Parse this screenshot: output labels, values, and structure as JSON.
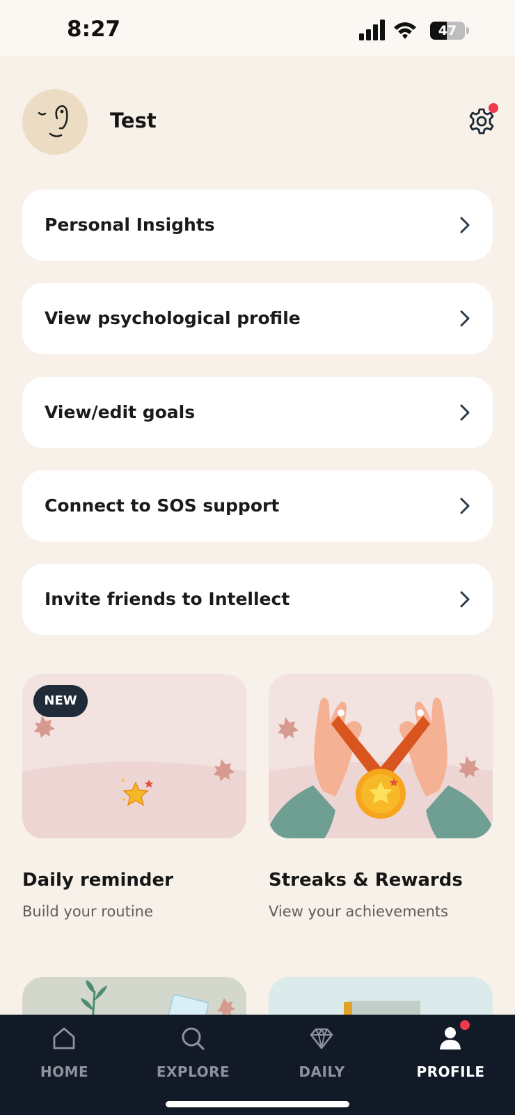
{
  "status_bar": {
    "time": "8:27",
    "battery_level": "47",
    "battery_fraction": 0.47
  },
  "profile": {
    "name": "Test",
    "avatar_icon": "face-line-art-icon",
    "settings_icon": "gear-icon",
    "settings_has_notification": true
  },
  "menu": {
    "items": [
      {
        "label": "Personal Insights"
      },
      {
        "label": "View psychological profile"
      },
      {
        "label": "View/edit goals"
      },
      {
        "label": "Connect to SOS support"
      },
      {
        "label": "Invite friends to Intellect"
      }
    ]
  },
  "tiles": {
    "daily_reminder": {
      "badge": "NEW",
      "title": "Daily reminder",
      "subtitle": "Build your routine"
    },
    "streaks": {
      "title": "Streaks & Rewards",
      "subtitle": "View your achievements"
    }
  },
  "tab_bar": {
    "tabs": [
      {
        "label": "HOME",
        "icon": "home-icon"
      },
      {
        "label": "EXPLORE",
        "icon": "search-icon"
      },
      {
        "label": "DAILY",
        "icon": "diamond-icon"
      },
      {
        "label": "PROFILE",
        "icon": "user-icon"
      }
    ],
    "active": "PROFILE"
  },
  "colors": {
    "background": "#f8f1e9",
    "card": "#ffffff",
    "tab_bar": "#111a26",
    "notification": "#ee3a4c",
    "tile_pink": "#f2e2e0"
  }
}
